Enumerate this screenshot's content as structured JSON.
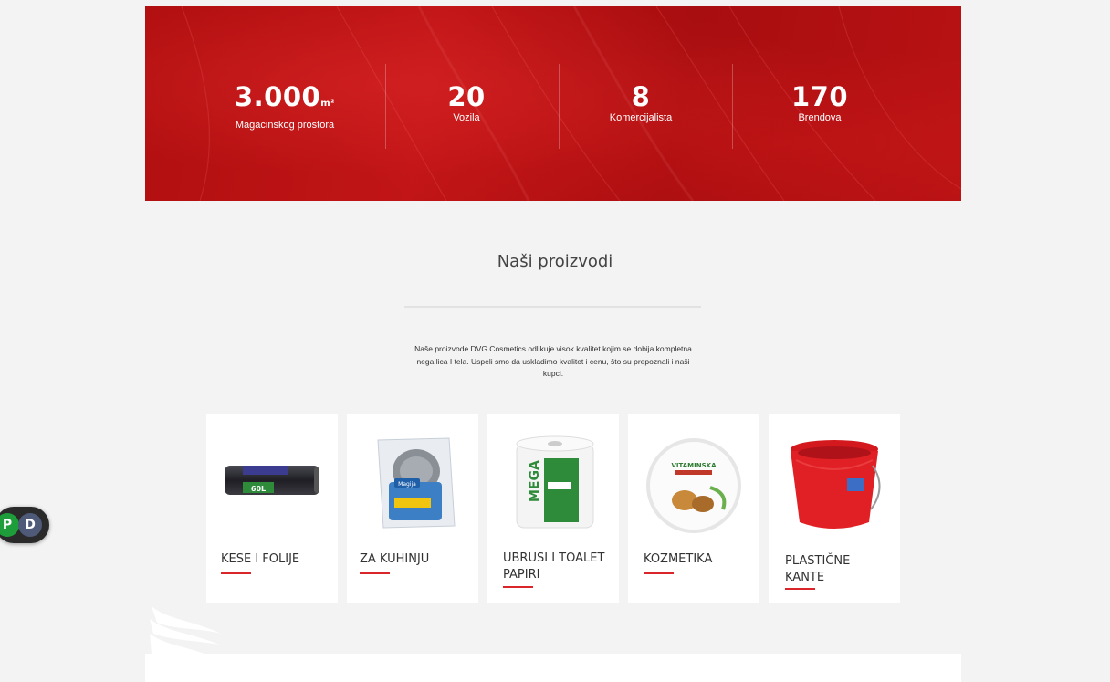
{
  "stats": [
    {
      "value": "3.000",
      "unit": "m²",
      "label": "Magacinskog prostora"
    },
    {
      "value": "20",
      "unit": "",
      "label": "Vozila"
    },
    {
      "value": "8",
      "unit": "",
      "label": "Komercijalista"
    },
    {
      "value": "170",
      "unit": "",
      "label": "Brendova"
    }
  ],
  "products_section": {
    "title": "Naši proizvodi",
    "intro": "Naše proizvode DVG Cosmetics odlikuje visok kvalitet kojim se dobija kompletna nega lica I tela. Uspeli smo da uskladimo kvalitet i cenu, što su prepoznali i naši kupci."
  },
  "products": [
    {
      "name": "KESE I FOLIJE",
      "icon": "garbage-bag-roll-image",
      "img_text": "60L"
    },
    {
      "name": "ZA KUHINJU",
      "icon": "steel-scrubber-pack-image",
      "img_text": "Magija"
    },
    {
      "name": "UBRUSI I TOALET PAPIRI",
      "icon": "paper-towel-roll-image",
      "img_text": "MEGA"
    },
    {
      "name": "KOZMETIKA",
      "icon": "cream-jar-image",
      "img_text": "VITAMINSKA"
    },
    {
      "name": "PLASTIČNE KANTE",
      "icon": "red-bucket-image",
      "img_text": ""
    }
  ],
  "accessibility": {
    "left": "P",
    "right": "D"
  },
  "colors": {
    "banner_red": "#b81214",
    "accent_red": "#d9262b",
    "background": "#f3f3f3"
  }
}
